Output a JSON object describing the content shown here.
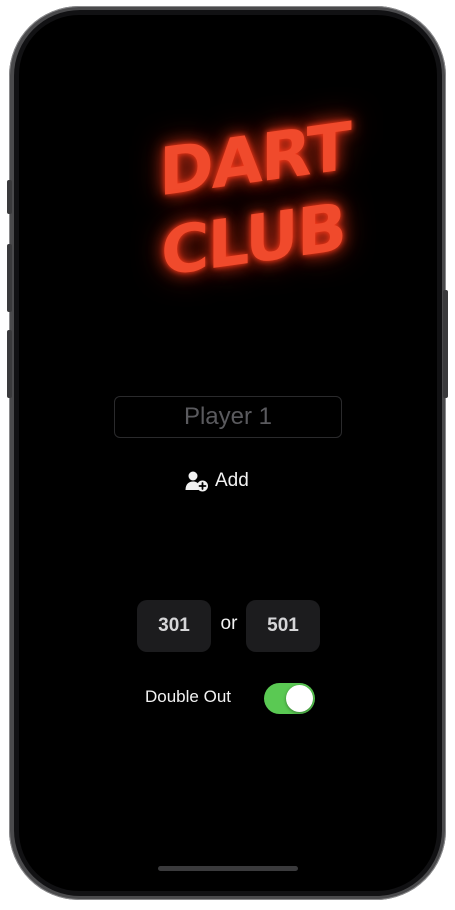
{
  "app": {
    "logo_line_1": "DART",
    "logo_line_2": "CLUB"
  },
  "players": {
    "input_placeholder": "Player 1",
    "add_label": "Add",
    "add_icon": "person-add-icon"
  },
  "game": {
    "option_1": "301",
    "or_label": "or",
    "option_2": "501",
    "double_out_label": "Double Out",
    "double_out_on": true
  },
  "colors": {
    "logo": "#f04a2c",
    "toggle_on": "#5ac953",
    "button_bg": "#1c1c1e",
    "screen_bg": "#000000"
  }
}
